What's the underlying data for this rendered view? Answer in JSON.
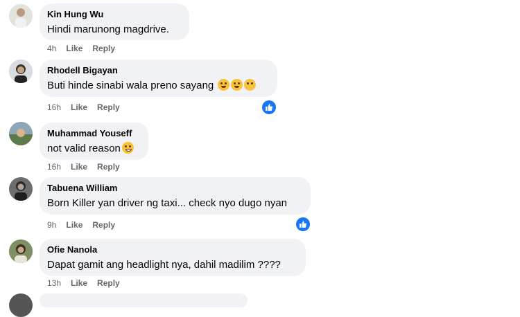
{
  "accent_color": "#1877f2",
  "comments": [
    {
      "author": "Kin Hung Wu",
      "text": "Hindi marunong magdrive.",
      "time": "4h",
      "like_label": "Like",
      "reply_label": "Reply",
      "emojis": [],
      "reaction": null
    },
    {
      "author": "Rhodell Bigayan",
      "text": "Buti hinde sinabi wala preno sayang",
      "time": "16h",
      "like_label": "Like",
      "reply_label": "Reply",
      "emojis": [
        "laughing-crying-emoji",
        "grinning-emoji",
        "pensive-emoji"
      ],
      "reaction": "like-reaction-icon"
    },
    {
      "author": "Muhammad Youseff",
      "text": "not valid reason",
      "time": "16h",
      "like_label": "Like",
      "reply_label": "Reply",
      "emojis": [
        "grimacing-emoji"
      ],
      "reaction": null
    },
    {
      "author": "Tabuena William",
      "text": "Born Killer yan driver ng taxi... check nyo dugo nyan",
      "time": "9h",
      "like_label": "Like",
      "reply_label": "Reply",
      "emojis": [],
      "reaction": "like-reaction-icon"
    },
    {
      "author": "Ofie Nanola",
      "text": "Dapat gamit ang headlight nya, dahil madilim ????",
      "time": "13h",
      "like_label": "Like",
      "reply_label": "Reply",
      "emojis": [],
      "reaction": null
    }
  ]
}
